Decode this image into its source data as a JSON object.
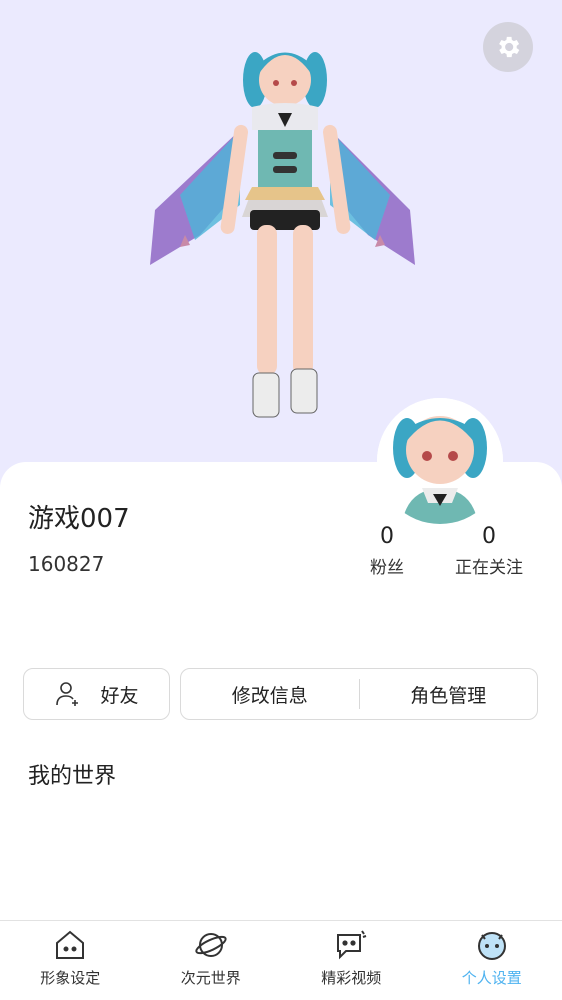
{
  "profile": {
    "username": "游戏007",
    "user_id": "160827"
  },
  "stats": [
    {
      "count": "0",
      "label": "粉丝"
    },
    {
      "count": "0",
      "label": "正在关注"
    }
  ],
  "actions": {
    "friends_label": "好友",
    "edit_info_label": "修改信息",
    "role_manage_label": "角色管理"
  },
  "sections": {
    "my_world_title": "我的世界"
  },
  "nav": {
    "items": [
      {
        "label": "形象设定",
        "icon": "house-icon"
      },
      {
        "label": "次元世界",
        "icon": "planet-icon"
      },
      {
        "label": "精彩视频",
        "icon": "chat-bubble-icon"
      },
      {
        "label": "个人设置",
        "icon": "avatar-face-icon"
      }
    ],
    "active_index": 3
  },
  "colors": {
    "hero_bg": "#EBEAFE",
    "active_accent": "#4FB3F0"
  }
}
